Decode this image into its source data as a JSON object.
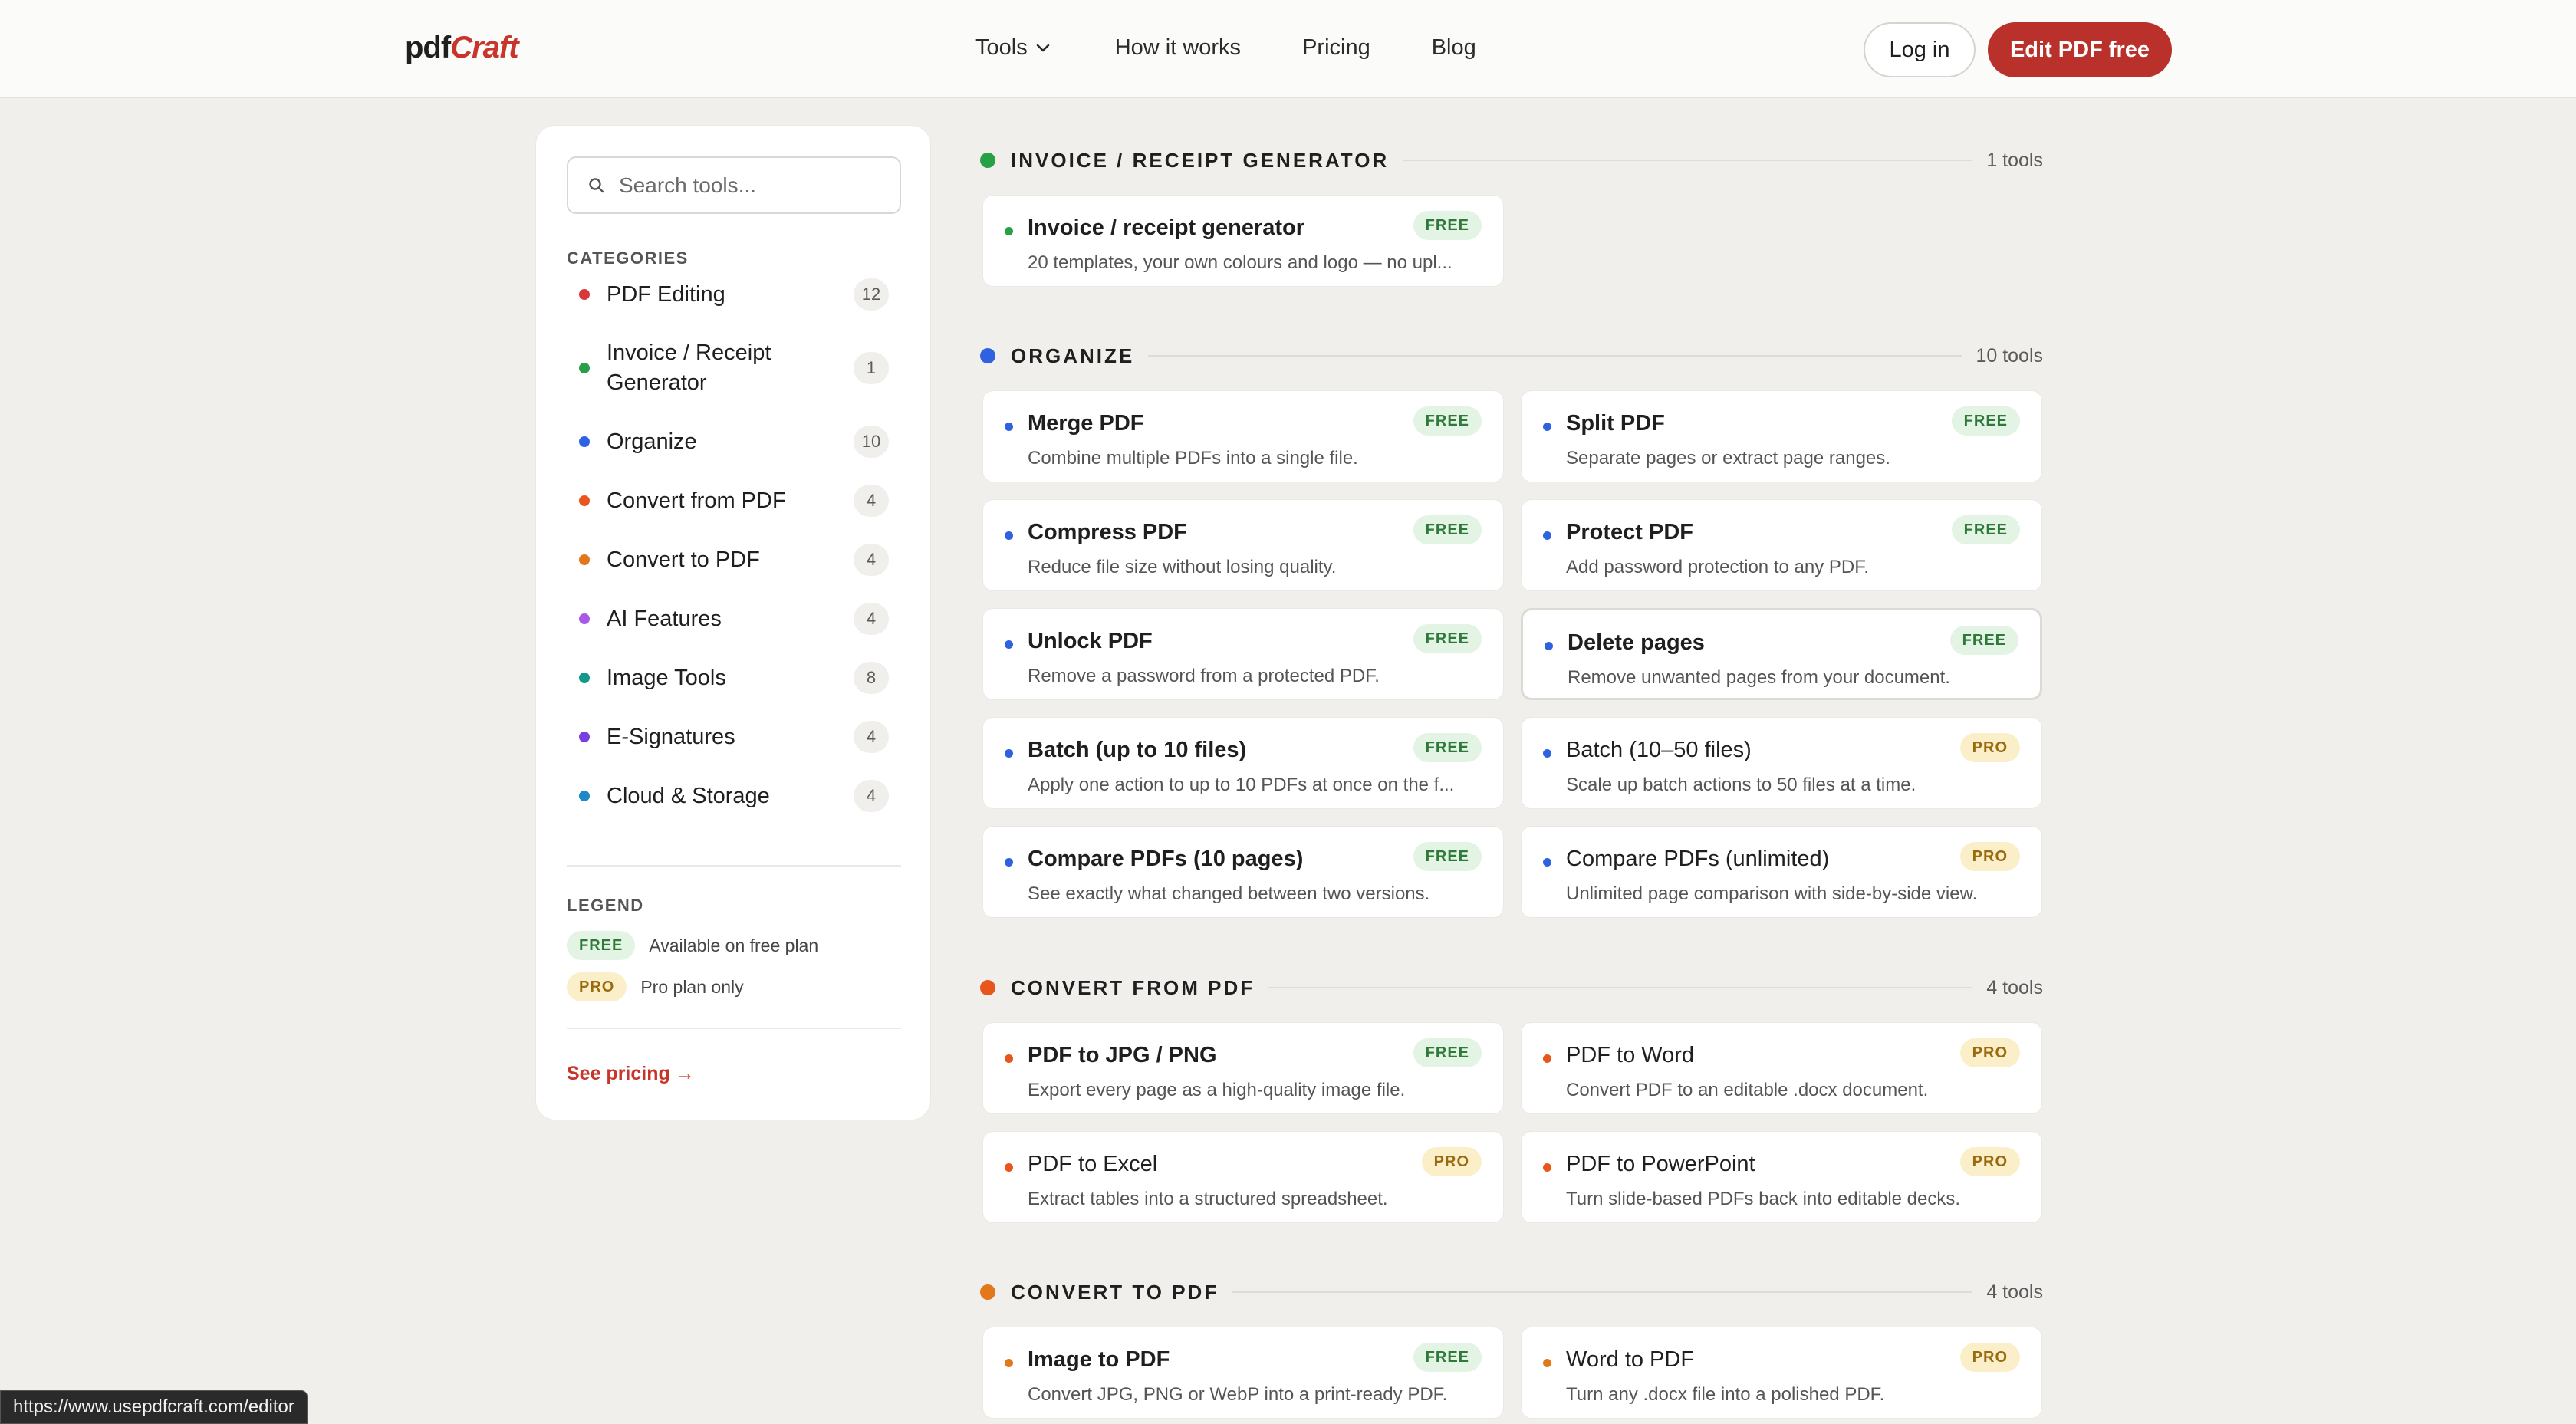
{
  "header": {
    "logo_pdf": "pdf",
    "logo_craft": "Craft",
    "nav": [
      "Tools",
      "How it works",
      "Pricing",
      "Blog"
    ],
    "login_label": "Log in",
    "cta_label": "Edit PDF free"
  },
  "sidebar": {
    "search_placeholder": "Search tools...",
    "categories_heading": "CATEGORIES",
    "categories": [
      {
        "label": "PDF Editing",
        "count": "12",
        "color": "#d9383a"
      },
      {
        "label": "Invoice / Receipt Generator",
        "count": "1",
        "color": "#27a046"
      },
      {
        "label": "Organize",
        "count": "10",
        "color": "#2f62e0"
      },
      {
        "label": "Convert from PDF",
        "count": "4",
        "color": "#e9561c"
      },
      {
        "label": "Convert to PDF",
        "count": "4",
        "color": "#e1781b"
      },
      {
        "label": "AI Features",
        "count": "4",
        "color": "#a958e8"
      },
      {
        "label": "Image Tools",
        "count": "8",
        "color": "#13998a"
      },
      {
        "label": "E-Signatures",
        "count": "4",
        "color": "#7a3fe0"
      },
      {
        "label": "Cloud & Storage",
        "count": "4",
        "color": "#1f88c9"
      }
    ],
    "legend_heading": "LEGEND",
    "legend": [
      {
        "badge": "FREE",
        "desc": "Available on free plan"
      },
      {
        "badge": "PRO",
        "desc": "Pro plan only"
      }
    ],
    "see_pricing": "See pricing →"
  },
  "sections": [
    {
      "title": "INVOICE / RECEIPT GENERATOR",
      "count": "1 tools",
      "color": "#27a046",
      "cards": [
        {
          "title": "Invoice / receipt generator",
          "desc": "20 templates, your own colours and logo — no upl...",
          "badge": "FREE"
        }
      ]
    },
    {
      "title": "ORGANIZE",
      "count": "10 tools",
      "color": "#2f62e0",
      "cards": [
        {
          "title": "Merge PDF",
          "desc": "Combine multiple PDFs into a single file.",
          "badge": "FREE"
        },
        {
          "title": "Split PDF",
          "desc": "Separate pages or extract page ranges.",
          "badge": "FREE"
        },
        {
          "title": "Compress PDF",
          "desc": "Reduce file size without losing quality.",
          "badge": "FREE"
        },
        {
          "title": "Protect PDF",
          "desc": "Add password protection to any PDF.",
          "badge": "FREE"
        },
        {
          "title": "Unlock PDF",
          "desc": "Remove a password from a protected PDF.",
          "badge": "FREE"
        },
        {
          "title": "Delete pages",
          "desc": "Remove unwanted pages from your document.",
          "badge": "FREE"
        },
        {
          "title": "Batch (up to 10 files)",
          "desc": "Apply one action to up to 10 PDFs at once on the f...",
          "badge": "FREE"
        },
        {
          "title": "Batch (10–50 files)",
          "desc": "Scale up batch actions to 50 files at a time.",
          "badge": "PRO"
        },
        {
          "title": "Compare PDFs (10 pages)",
          "desc": "See exactly what changed between two versions.",
          "badge": "FREE"
        },
        {
          "title": "Compare PDFs (unlimited)",
          "desc": "Unlimited page comparison with side-by-side view.",
          "badge": "PRO"
        }
      ]
    },
    {
      "title": "CONVERT FROM PDF",
      "count": "4 tools",
      "color": "#e9561c",
      "cards": [
        {
          "title": "PDF to JPG / PNG",
          "desc": "Export every page as a high-quality image file.",
          "badge": "FREE"
        },
        {
          "title": "PDF to Word",
          "desc": "Convert PDF to an editable .docx document.",
          "badge": "PRO"
        },
        {
          "title": "PDF to Excel",
          "desc": "Extract tables into a structured spreadsheet.",
          "badge": "PRO"
        },
        {
          "title": "PDF to PowerPoint",
          "desc": "Turn slide-based PDFs back into editable decks.",
          "badge": "PRO"
        }
      ]
    },
    {
      "title": "CONVERT TO PDF",
      "count": "4 tools",
      "color": "#e1781b",
      "cards": [
        {
          "title": "Image to PDF",
          "desc": "Convert JPG, PNG or WebP into a print-ready PDF.",
          "badge": "FREE"
        },
        {
          "title": "Word to PDF",
          "desc": "Turn any .docx file into a polished PDF.",
          "badge": "PRO"
        }
      ]
    }
  ],
  "status_url": "https://www.usepdfcraft.com/editor"
}
